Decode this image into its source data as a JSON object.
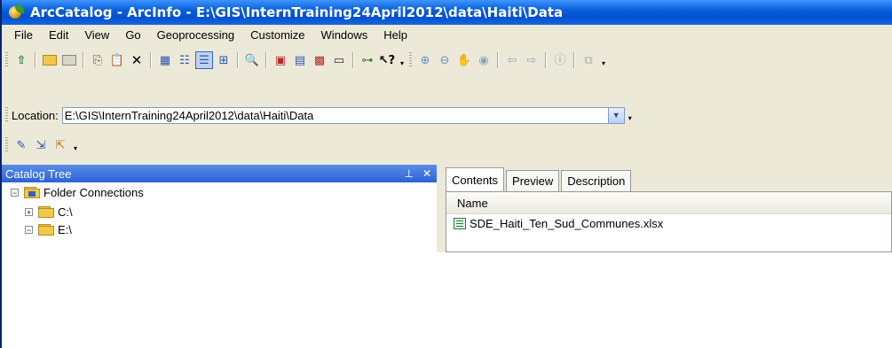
{
  "window": {
    "title": "ArcCatalog - ArcInfo - E:\\GIS\\InternTraining24April2012\\data\\Haiti\\Data"
  },
  "menu": [
    "File",
    "Edit",
    "View",
    "Go",
    "Geoprocessing",
    "Customize",
    "Windows",
    "Help"
  ],
  "location": {
    "label": "Location:",
    "value": "E:\\GIS\\InternTraining24April2012\\data\\Haiti\\Data"
  },
  "catalog_tree": {
    "title": "Catalog Tree",
    "pin": "↕",
    "close": "✕",
    "nodes": [
      {
        "label": "Folder Connections",
        "expander": "−"
      },
      {
        "label": "C:\\",
        "expander": "+"
      },
      {
        "label": "E:\\",
        "expander": "−"
      }
    ]
  },
  "tabs": [
    "Contents",
    "Preview",
    "Description"
  ],
  "contents": {
    "column_name": "Name",
    "items": [
      "SDE_Haiti_Ten_Sud_Communes.xlsx"
    ]
  },
  "icons": {
    "toolbar1": [
      "up-one-level-icon",
      "connect-folder-icon",
      "disconnect-folder-icon",
      "copy-icon",
      "paste-icon",
      "delete-icon",
      "large-icons-icon",
      "list-icon",
      "details-icon",
      "thumbnails-icon",
      "search-icon",
      "arctoolbox-icon",
      "catalog-window-icon",
      "model-icon",
      "command-line-icon",
      "python-icon",
      "whats-this-icon",
      "zoom-in-icon",
      "zoom-out-icon",
      "pan-icon",
      "full-extent-icon",
      "back-icon",
      "forward-icon",
      "identify-icon",
      "create-thumbnail-icon"
    ],
    "toolbar3": [
      "metadata-edit-icon",
      "metadata-import-icon",
      "metadata-export-icon"
    ]
  }
}
